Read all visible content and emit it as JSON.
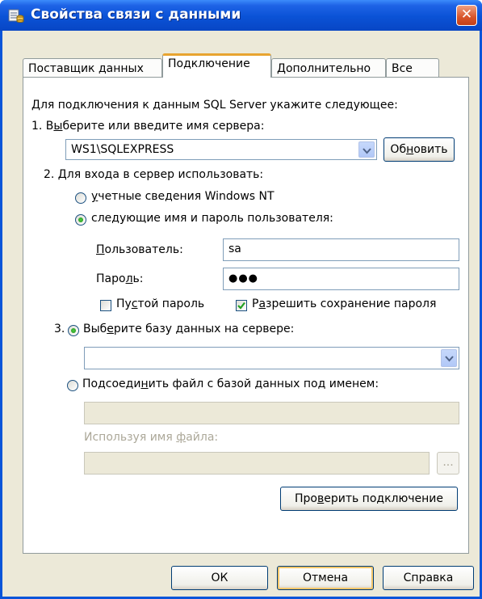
{
  "window": {
    "title": "Свойства связи с данными",
    "close_label": "✕",
    "icons": {
      "app": "data-link-icon",
      "close": "close-icon"
    },
    "accent": "#0a55d9"
  },
  "tabs": [
    "Поставщик данных",
    "Подключение",
    "Дополнительно",
    "Все"
  ],
  "active_tab": "Подключение",
  "connection": {
    "intro": "Для подключения к данным SQL Server укажите следующее:",
    "step1": {
      "label_pre": "1. В",
      "label_u": "ы",
      "label_post": "берите или введите имя сервера:",
      "server_value": "WS1\\SQLEXPRESS",
      "refresh_pre": "Об",
      "refresh_u": "н",
      "refresh_post": "овить"
    },
    "step2": {
      "label": "2. Для входа в сервер использовать:",
      "opt_nt_u": "у",
      "opt_nt_post": "четные сведения Windows NT",
      "opt_nt_selected": false,
      "opt_user_pre": "сле",
      "opt_user_u": "д",
      "opt_user_post": "ующие имя и пароль пользователя:",
      "opt_user_selected": true,
      "user_label_u": "П",
      "user_label_post": "ользователь:",
      "user_value": "sa",
      "pwd_label_pre": "Паро",
      "pwd_label_u": "л",
      "pwd_label_post": "ь:",
      "pwd_value": "●●●",
      "empty_pwd_pre": "Пу",
      "empty_pwd_u": "с",
      "empty_pwd_post": "той пароль",
      "empty_pwd_checked": false,
      "save_pwd_pre": "Р",
      "save_pwd_u": "а",
      "save_pwd_post": "зрешить сохранение пароля",
      "save_pwd_checked": true
    },
    "step3": {
      "number": "3.",
      "opt_db_pre": "Выб",
      "opt_db_u": "е",
      "opt_db_post": "рите базу данных на сервере:",
      "opt_db_selected": true,
      "db_value": "",
      "opt_file_pre": "Подсоеди",
      "opt_file_u": "н",
      "opt_file_post": "ить файл с базой данных под именем:",
      "opt_file_selected": false,
      "file_value": "",
      "filename_pre": "Используя имя ",
      "filename_u": "ф",
      "filename_post": "айла:",
      "filename_value": "",
      "browse_label": "..."
    },
    "test_pre": "Про",
    "test_u": "в",
    "test_post": "ерить подключение"
  },
  "buttons": {
    "ok": "ОК",
    "cancel": "Отмена",
    "help": "Справка"
  }
}
